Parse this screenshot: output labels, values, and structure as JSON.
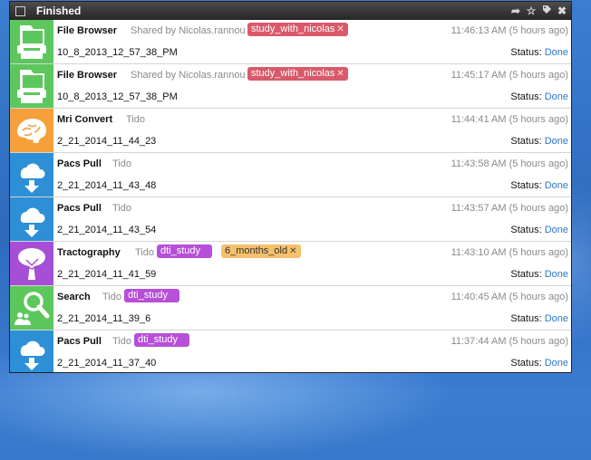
{
  "header": {
    "title": "Finished"
  },
  "rows": [
    {
      "name": "File Browser",
      "shared": "Shared by Nicolas.rannou",
      "tags": [
        {
          "text": "study_with_nicolas",
          "x": "✕",
          "color": "red"
        }
      ],
      "time": "11:46:13 AM (5 hours ago)",
      "sub": "10_8_2013_12_57_38_PM",
      "status_label": "Status:",
      "status_value": "Done",
      "icon": "folder-printer-icon"
    },
    {
      "name": "File Browser",
      "shared": "Shared by Nicolas.rannou",
      "tags": [
        {
          "text": "study_with_nicolas",
          "x": "✕",
          "color": "red"
        }
      ],
      "time": "11:45:17 AM (5 hours ago)",
      "sub": "10_8_2013_12_57_38_PM",
      "status_label": "Status:",
      "status_value": "Done",
      "icon": "folder-printer-icon"
    },
    {
      "name": "Mri Convert",
      "shared": "Tido",
      "tags": [],
      "time": "11:44:41 AM (5 hours ago)",
      "sub": "2_21_2014_11_44_23",
      "status_label": "Status:",
      "status_value": "Done",
      "icon": "brain-icon"
    },
    {
      "name": "Pacs Pull",
      "shared": "Tido",
      "tags": [],
      "time": "11:43:58 AM (5 hours ago)",
      "sub": "2_21_2014_11_43_48",
      "status_label": "Status:",
      "status_value": "Done",
      "icon": "cloud-download-icon"
    },
    {
      "name": "Pacs Pull",
      "shared": "Tido",
      "tags": [],
      "time": "11:43:57 AM (5 hours ago)",
      "sub": "2_21_2014_11_43_54",
      "status_label": "Status:",
      "status_value": "Done",
      "icon": "cloud-download-icon"
    },
    {
      "name": "Tractography",
      "shared": "Tido",
      "tags": [
        {
          "text": "dti_study",
          "x": "",
          "color": "purple"
        },
        {
          "text": "6_months_old",
          "x": "✕",
          "color": "orange"
        }
      ],
      "time": "11:43:10 AM (5 hours ago)",
      "sub": "2_21_2014_11_41_59",
      "status_label": "Status:",
      "status_value": "Done",
      "icon": "tree-icon"
    },
    {
      "name": "Search",
      "shared": "Tido",
      "tags": [
        {
          "text": "dti_study",
          "x": "",
          "color": "purple"
        }
      ],
      "time": "11:40:45 AM (5 hours ago)",
      "sub": "2_21_2014_11_39_6",
      "status_label": "Status:",
      "status_value": "Done",
      "icon": "search-users-icon"
    },
    {
      "name": "Pacs Pull",
      "shared": "Tido",
      "tags": [
        {
          "text": "dti_study",
          "x": "",
          "color": "purple"
        }
      ],
      "time": "11:37:44 AM (5 hours ago)",
      "sub": "2_21_2014_11_37_40",
      "status_label": "Status:",
      "status_value": "Done",
      "icon": "cloud-download-icon"
    }
  ],
  "colors": {
    "green": "#5cc75c",
    "orange": "#f5a03a",
    "blue": "#2d8fd6",
    "purple": "#a64ed6",
    "link": "#2a78c9"
  }
}
